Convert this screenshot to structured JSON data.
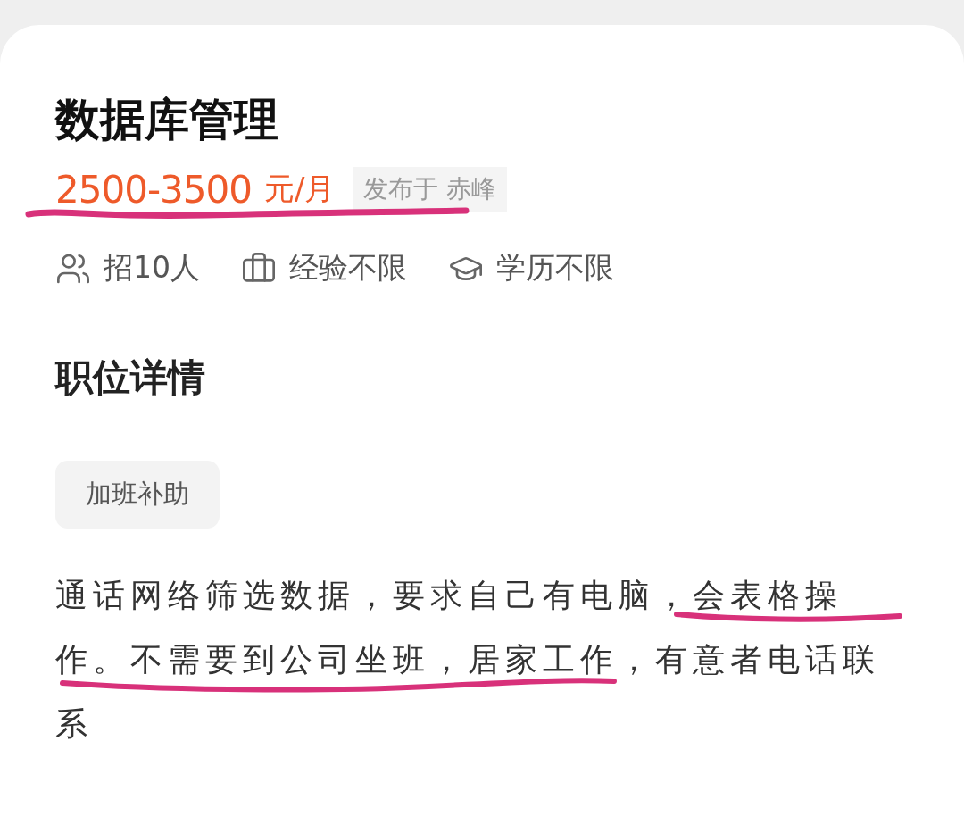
{
  "job": {
    "title": "数据库管理",
    "salary": {
      "amount": "2500-3500",
      "unit": "元/月"
    },
    "location_badge": "发布于 赤峰",
    "requirements": [
      {
        "kind": "headcount",
        "text": "招10人"
      },
      {
        "kind": "experience",
        "text": "经验不限"
      },
      {
        "kind": "education",
        "text": "学历不限"
      }
    ]
  },
  "details": {
    "heading": "职位详情",
    "tags": [
      "加班补助"
    ],
    "description": "通话网络筛选数据，要求自己有电脑，会表格操作。不需要到公司坐班，居家工作，有意者电话联系"
  }
}
